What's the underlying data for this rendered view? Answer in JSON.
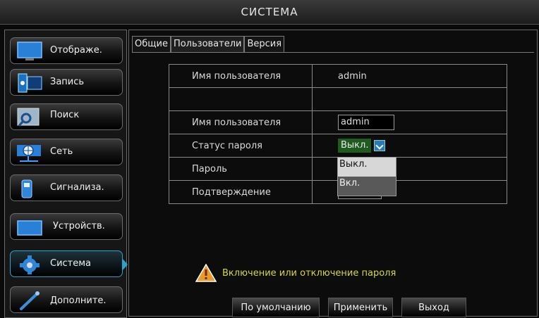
{
  "window": {
    "title": "СИСТЕМА"
  },
  "sidebar": {
    "items": [
      {
        "label": "Отображе.",
        "icon": "monitor-icon"
      },
      {
        "label": "Запись",
        "icon": "film-icon"
      },
      {
        "label": "Поиск",
        "icon": "magnifier-icon"
      },
      {
        "label": "Сеть",
        "icon": "network-icon"
      },
      {
        "label": "Сигнализа.",
        "icon": "alarm-icon"
      },
      {
        "label": "Устройств.",
        "icon": "device-icon"
      },
      {
        "label": "Система",
        "icon": "gear-icon",
        "active": true
      },
      {
        "label": "Дополните.",
        "icon": "wrench-icon"
      }
    ]
  },
  "tabs": [
    {
      "label": "Общие"
    },
    {
      "label": "Пользователи",
      "active": true
    },
    {
      "label": "Версия"
    }
  ],
  "form": {
    "row1_label": "Имя пользователя",
    "row1_value": "admin",
    "username_label": "Имя пользователя",
    "username_value": "admin",
    "password_status_label": "Статус пароля",
    "password_status_value": "Выкл.",
    "password_label": "Пароль",
    "confirm_label": "Подтверждение"
  },
  "dropdown": {
    "options": [
      "Выкл.",
      "Вкл."
    ],
    "highlighted": "Выкл."
  },
  "hint": {
    "text": "Включение или отключение пароля"
  },
  "buttons": {
    "default": "По умолчанию",
    "apply": "Применить",
    "exit": "Выход"
  },
  "colors": {
    "accent": "#2aa3c9",
    "hint_text": "#d6d640",
    "selected_value_bg": "#1f5a1f"
  }
}
